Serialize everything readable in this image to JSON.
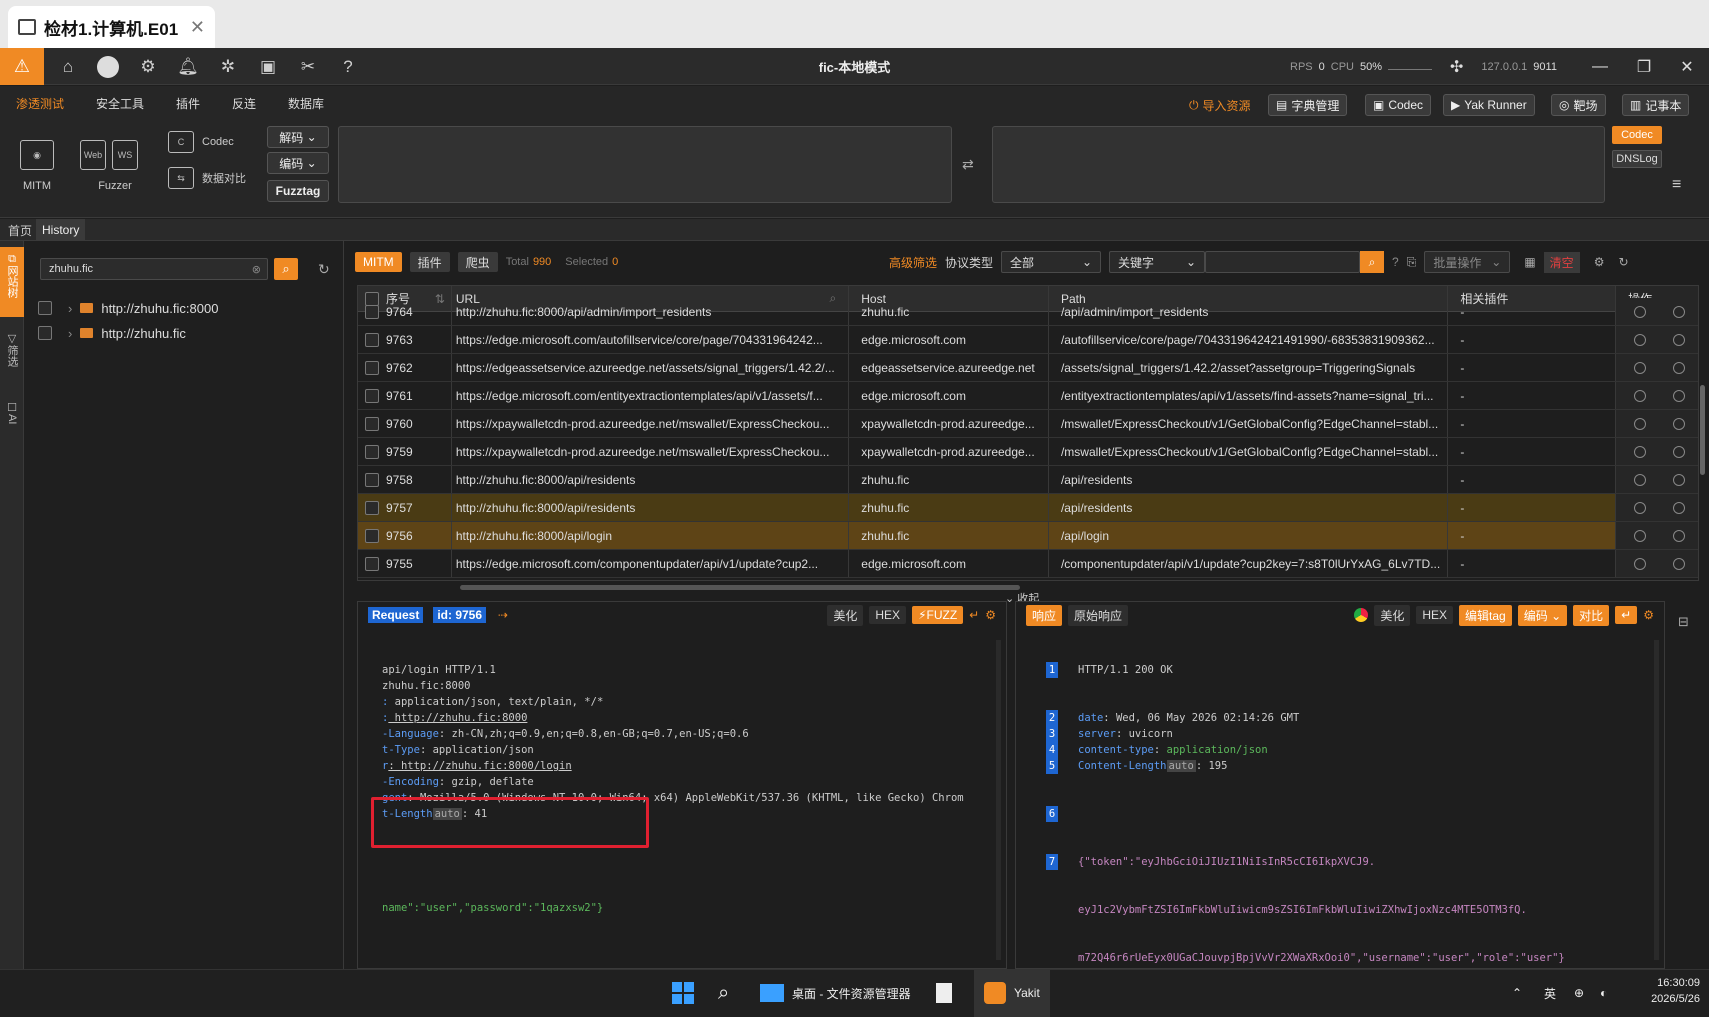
{
  "window": {
    "tab_title": "检材1.计算机.E01",
    "app_title": "fic-本地模式"
  },
  "stats": {
    "rps_label": "RPS",
    "rps": "0",
    "cpu_label": "CPU",
    "cpu": "50%",
    "host": "127.0.0.1",
    "port": "9011"
  },
  "menu": [
    "渗透测试",
    "安全工具",
    "插件",
    "反连",
    "数据库"
  ],
  "top_buttons": {
    "import": "导入资源",
    "dict": "字典管理",
    "codec": "Codec",
    "yak_runner": "Yak Runner",
    "range": "靶场",
    "notepad": "记事本"
  },
  "tools": {
    "mitm": "MITM",
    "fuzzer": "Fuzzer",
    "codec": "Codec",
    "compare": "数据对比",
    "decode": "解码",
    "encode": "编码",
    "fuzztag": "Fuzztag",
    "codec_tab": "Codec",
    "dnslog_tab": "DNSLog"
  },
  "page_tabs": [
    "首页",
    "History"
  ],
  "side_tabs": [
    "网站树",
    "筛选",
    "AI"
  ],
  "tree": {
    "search_value": "zhuhu.fic",
    "items": [
      "http://zhuhu.fic:8000",
      "http://zhuhu.fic"
    ]
  },
  "filter": {
    "tags": [
      "MITM",
      "插件",
      "爬虫"
    ],
    "total_label": "Total",
    "total": "990",
    "selected_label": "Selected",
    "selected": "0",
    "advanced": "高级筛选",
    "protocol_label": "协议类型",
    "protocol_value": "全部",
    "keyword_label": "关键字",
    "batch": "批量操作",
    "clear": "清空"
  },
  "table": {
    "headers": [
      "序号",
      "URL",
      "Host",
      "Path",
      "相关插件",
      "操作"
    ],
    "rows": [
      {
        "id": "9764",
        "url": "http://zhuhu.fic:8000/api/admin/import_residents",
        "host": "zhuhu.fic",
        "path": "/api/admin/import_residents",
        "plugin": "-"
      },
      {
        "id": "9763",
        "url": "https://edge.microsoft.com/autofillservice/core/page/704331964242...",
        "host": "edge.microsoft.com",
        "path": "/autofillservice/core/page/7043319642421491990/-68353831909362...",
        "plugin": "-"
      },
      {
        "id": "9762",
        "url": "https://edgeassetservice.azureedge.net/assets/signal_triggers/1.42.2/...",
        "host": "edgeassetservice.azureedge.net",
        "path": "/assets/signal_triggers/1.42.2/asset?assetgroup=TriggeringSignals",
        "plugin": "-"
      },
      {
        "id": "9761",
        "url": "https://edge.microsoft.com/entityextractiontemplates/api/v1/assets/f...",
        "host": "edge.microsoft.com",
        "path": "/entityextractiontemplates/api/v1/assets/find-assets?name=signal_tri...",
        "plugin": "-"
      },
      {
        "id": "9760",
        "url": "https://xpaywalletcdn-prod.azureedge.net/mswallet/ExpressCheckou...",
        "host": "xpaywalletcdn-prod.azureedge...",
        "path": "/mswallet/ExpressCheckout/v1/GetGlobalConfig?EdgeChannel=stabl...",
        "plugin": "-"
      },
      {
        "id": "9759",
        "url": "https://xpaywalletcdn-prod.azureedge.net/mswallet/ExpressCheckou...",
        "host": "xpaywalletcdn-prod.azureedge...",
        "path": "/mswallet/ExpressCheckout/v1/GetGlobalConfig?EdgeChannel=stabl...",
        "plugin": "-"
      },
      {
        "id": "9758",
        "url": "http://zhuhu.fic:8000/api/residents",
        "host": "zhuhu.fic",
        "path": "/api/residents",
        "plugin": "-"
      },
      {
        "id": "9757",
        "url": "http://zhuhu.fic:8000/api/residents",
        "host": "zhuhu.fic",
        "path": "/api/residents",
        "plugin": "-"
      },
      {
        "id": "9756",
        "url": "http://zhuhu.fic:8000/api/login",
        "host": "zhuhu.fic",
        "path": "/api/login",
        "plugin": "-"
      },
      {
        "id": "9755",
        "url": "https://edge.microsoft.com/componentupdater/api/v1/update?cup2...",
        "host": "edge.microsoft.com",
        "path": "/componentupdater/api/v1/update?cup2key=7:s8T0lUrYxAG_6Lv7TD...",
        "plugin": "-"
      }
    ],
    "collapse": "收起"
  },
  "request": {
    "title": "Request",
    "id_label": "id: 9756",
    "buttons": [
      "美化",
      "HEX",
      "FUZZ"
    ],
    "lines": [
      [
        "",
        "api/login HTTP/1.1"
      ],
      [
        "",
        "zhuhu.fic:8000"
      ],
      [
        ":",
        " application/json, text/plain, */*"
      ],
      [
        ":",
        " http://zhuhu.fic:8000"
      ],
      [
        "-Language",
        ": zh-CN,zh;q=0.9,en;q=0.8,en-GB;q=0.7,en-US;q=0.6"
      ],
      [
        "t-Type",
        ": application/json"
      ],
      [
        "r",
        ": http://zhuhu.fic:8000/login"
      ],
      [
        "-Encoding",
        ": gzip, deflate"
      ],
      [
        "gent",
        ": Mozilla/5.0 (Windows NT 10.0; Win64; x64) AppleWebKit/537.36 (KHTML, like Gecko) Chrom"
      ],
      [
        "t-Length",
        ": 41"
      ]
    ],
    "auto_tag": "auto",
    "body": "name\":\"user\",\"password\":\"1qazxsw2\"}"
  },
  "response": {
    "tabs": [
      "响应",
      "原始响应"
    ],
    "buttons": [
      "美化",
      "HEX",
      "编辑tag",
      "编码",
      "对比"
    ],
    "status": "HTTP/1.1 200 OK",
    "headers": [
      [
        "date",
        "Wed, 06 May 2026 02:14:26 GMT"
      ],
      [
        "server",
        "uvicorn"
      ],
      [
        "content-type",
        "application/json"
      ],
      [
        "Content-Length",
        "195"
      ]
    ],
    "auto_tag": "auto",
    "body_line1": "{\"token\":\"eyJhbGciOiJIUzI1NiIsInR5cCI6IkpXVCJ9.",
    "body_line2": "eyJ1c2VybmFtZSI6ImFkbWluIiwicm9sZSI6ImFkbWluIiwiZXhwIjoxNzc4MTE5OTM3fQ.",
    "body_line3": "m72Q46r6rUeEyx0UGaCJouvpjBpjVvVr2XWaXRxOoi0\",\"username\":\"user\",\"role\":\"user\"}"
  },
  "taskbar": {
    "explorer": "桌面 - 文件资源管理器",
    "yakit": "Yakit",
    "ime": "英",
    "time": "16:30:09",
    "date": "2026/5/26"
  },
  "colors": {
    "accent": "#f08a24",
    "blue": "#1e66d2",
    "highlight": "#5e4416",
    "red_box": "#e02030"
  }
}
